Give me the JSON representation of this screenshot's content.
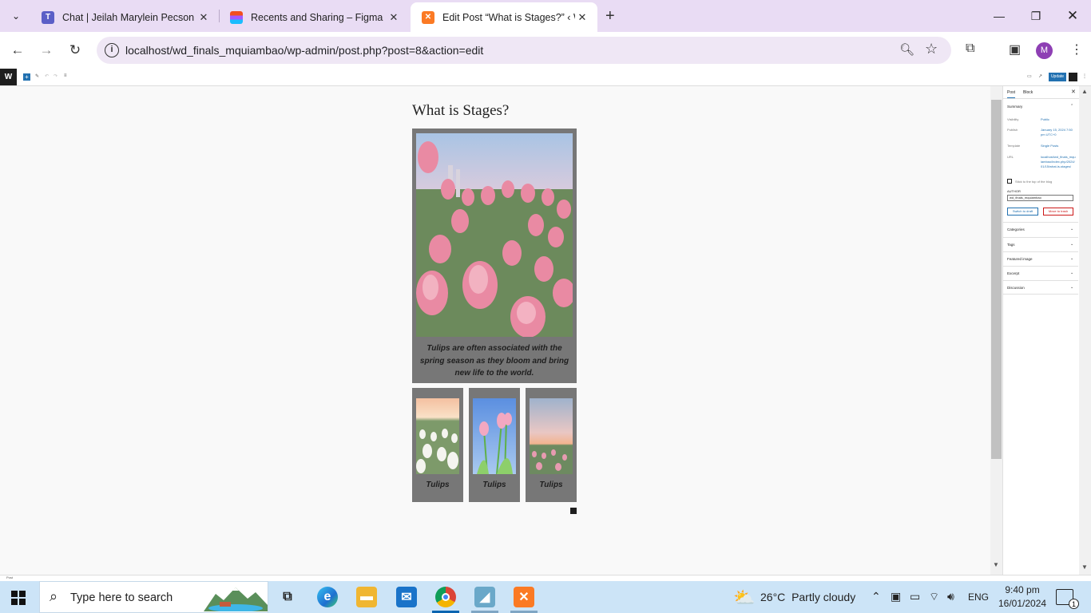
{
  "browser": {
    "tabs": [
      {
        "label": "Chat | Jeilah Marylein Pecson | M",
        "icon": "teams-icon"
      },
      {
        "label": "Recents and Sharing – Figma",
        "icon": "figma-icon"
      },
      {
        "label": "Edit Post “What is Stages?” ‹ Wo",
        "icon": "xampp-icon"
      }
    ],
    "url": "localhost/wd_finals_mquiambao/wp-admin/post.php?post=8&action=edit",
    "profile_initial": "M"
  },
  "editor": {
    "post_title": "What is Stages?",
    "main_caption": "Tulips are often associated with the spring season as they bloom and bring new life to the world.",
    "gallery": [
      {
        "caption": "Tulips"
      },
      {
        "caption": "Tulips"
      },
      {
        "caption": "Tulips"
      }
    ],
    "update_label": "Update"
  },
  "sidebar": {
    "tabs": [
      "Post",
      "Block"
    ],
    "summary_title": "Summary",
    "rows": [
      {
        "label": "Visibility",
        "value": "Public"
      },
      {
        "label": "Publish",
        "value": "January 15, 2024 7:50 pm UTC+0"
      },
      {
        "label": "Template",
        "value": "Single Posts"
      },
      {
        "label": "URL",
        "value": "localhost/wd_finals_mquiambao/index.php/2024/01/15/what-is-stages/"
      }
    ],
    "sticky_label": "Stick to the top of the blog",
    "author_label": "AUTHOR",
    "author_value": "wd_finals_mquiambao",
    "switch_draft": "Switch to draft",
    "move_trash": "Move to trash",
    "panels": [
      "Categories",
      "Tags",
      "Featured image",
      "Excerpt",
      "Discussion"
    ]
  },
  "status_bar": {
    "text": "Post"
  },
  "taskbar": {
    "search_placeholder": "Type here to search",
    "weather_temp": "26°C",
    "weather_desc": "Partly cloudy",
    "lang": "ENG",
    "time": "9:40 pm",
    "date": "16/01/2024",
    "notifications": "1"
  }
}
